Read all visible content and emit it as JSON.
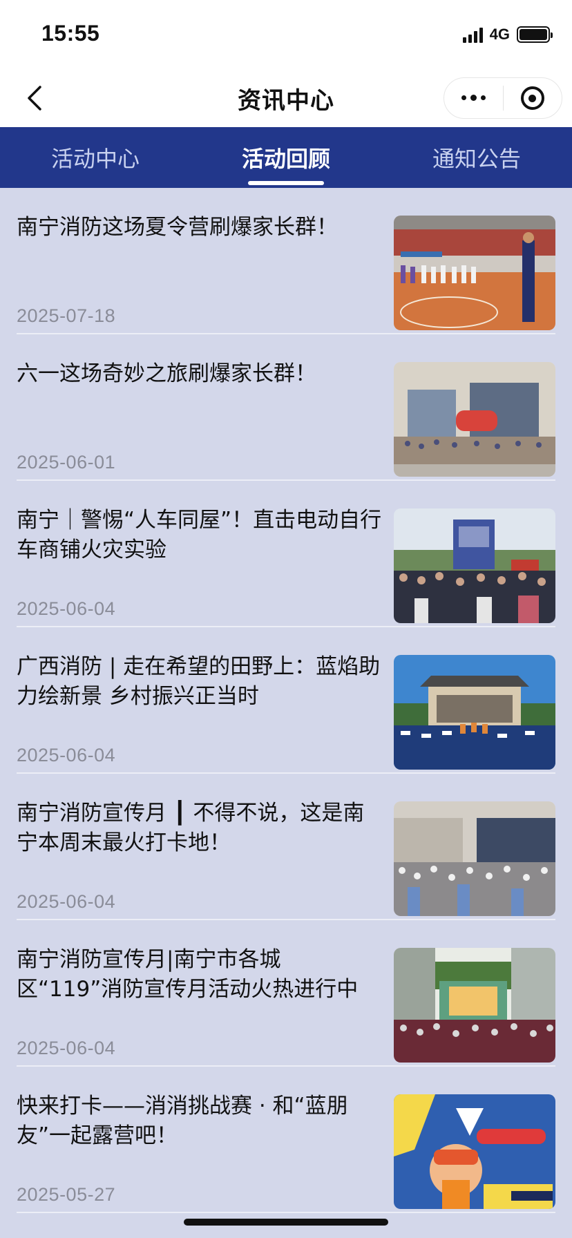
{
  "status_bar": {
    "time": "15:55",
    "network": "4G"
  },
  "nav": {
    "title": "资讯中心"
  },
  "tabs": [
    {
      "label": "活动中心",
      "active": false
    },
    {
      "label": "活动回顾",
      "active": true
    },
    {
      "label": "通知公告",
      "active": false
    }
  ],
  "articles": [
    {
      "title": "南宁消防这场夏令营刷爆家长群！",
      "date": "2025-07-18",
      "image": "gym-camp-photo"
    },
    {
      "title": "六一这场奇妙之旅刷爆家长群！",
      "date": "2025-06-01",
      "image": "building-crowd-photo"
    },
    {
      "title": "南宁｜警惕“人车同屋”！直击电动自行车商铺火灾实验",
      "date": "2025-06-04",
      "image": "fire-experiment-crowd-photo"
    },
    {
      "title": "广西消防 | 走在希望的田野上：蓝焰助力绘新景 乡村振兴正当时",
      "date": "2025-06-04",
      "image": "village-stage-photo"
    },
    {
      "title": "南宁消防宣传月 ┃ 不得不说，这是南宁本周末最火打卡地！",
      "date": "2025-06-04",
      "image": "museum-crowd-photo"
    },
    {
      "title": "南宁消防宣传月|南宁市各城区“119”消防宣传月活动火热进行中",
      "date": "2025-06-04",
      "image": "school-stage-photo"
    },
    {
      "title": "快来打卡——消消挑战赛 · 和“蓝朋友”一起露营吧！",
      "date": "2025-05-27",
      "image": "cartoon-poster-image"
    }
  ],
  "colors": {
    "tab_bar": "#22378b",
    "page_bg": "#d3d7ea"
  }
}
